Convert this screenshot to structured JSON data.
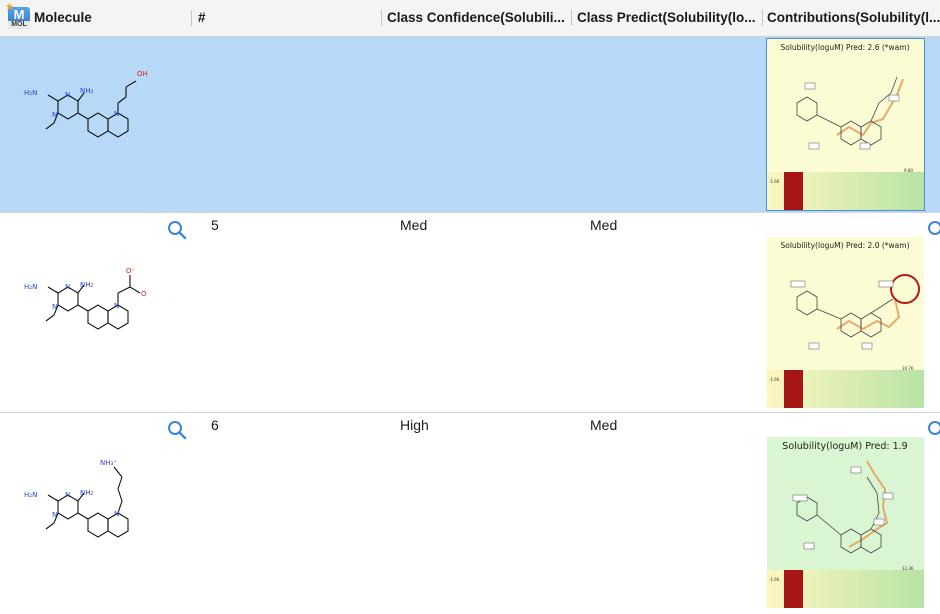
{
  "header": {
    "icon_top": "M",
    "icon_bottom": "MOL",
    "molecule": "Molecule",
    "number": "#",
    "class_confidence": "Class Confidence(Solubili...",
    "class_predict": "Class Predict(Solubility(lo...",
    "contributions": "Contributions(Solubility(l..."
  },
  "rows": [
    {
      "number": "",
      "class_confidence": "",
      "class_predict": "",
      "contribution_title": "Solubility(loguM) Pred: 2.6 (*wam)",
      "contribution_bg": "#fbfbd4",
      "scale_min_label": "-1.60",
      "scale_max_label": "9.80",
      "structure_labels": {
        "nh2_left": "H₂N",
        "nh2_right": "NH₂",
        "n1": "N",
        "n2": "N",
        "n3": "N",
        "oh": "OH"
      }
    },
    {
      "number": "5",
      "class_confidence": "Med",
      "class_predict": "Med",
      "contribution_title": "Solubility(loguM) Pred: 2.0 (*wam)",
      "contribution_bg": "#fbfbd4",
      "scale_min_label": "-1.60",
      "scale_max_label": "10.76",
      "structure_labels": {
        "nh2_left": "H₂N",
        "nh2_right": "NH₂",
        "n1": "N",
        "n2": "N",
        "n3": "N",
        "o1": "O",
        "o2": "O⁻"
      }
    },
    {
      "number": "6",
      "class_confidence": "High",
      "class_predict": "Med",
      "contribution_title": "Solubility(loguM) Pred: 1.9",
      "contribution_bg": "#d9f5d2",
      "scale_min_label": "-1.60",
      "scale_max_label": "12.36",
      "structure_labels": {
        "nh2_left": "H₂N",
        "nh2_right": "NH₂",
        "n1": "N",
        "n2": "N",
        "n3": "N",
        "nh3": "NH₃⁺"
      }
    }
  ],
  "colors": {
    "selected_row": "#b7d8f6",
    "nitrogen": "#2f3fd8",
    "oxygen": "#d81f1f",
    "highlight": "#f0b060"
  }
}
